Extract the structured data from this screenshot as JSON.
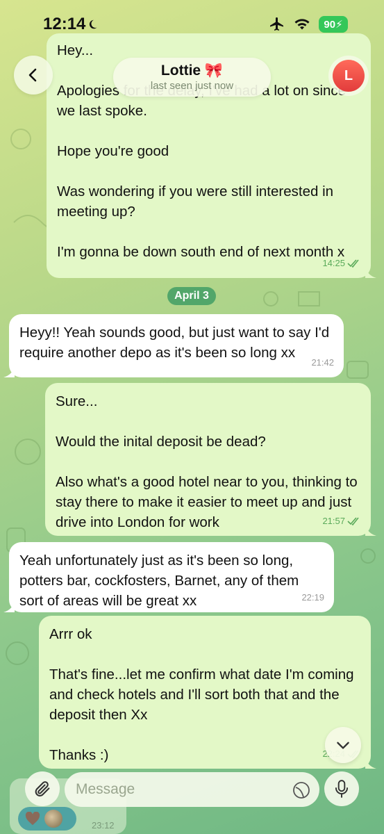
{
  "status_bar": {
    "time": "12:14",
    "battery": "90"
  },
  "header": {
    "contact_name": "Lottie 🎀",
    "last_seen": "last seen just now",
    "avatar_initial": "L"
  },
  "messages": [
    {
      "direction": "out",
      "text": "Hey...\n\nApologies for the delay, I've had a lot on since we last spoke.\n\nHope you're good\n\nWas wondering if you were still interested in meeting up?\n\nI'm gonna be down south end of next month x",
      "time": "14:25",
      "status": "read"
    },
    {
      "direction": "date",
      "text": "April 3"
    },
    {
      "direction": "in",
      "text": "Heyy!! Yeah sounds good, but just want to say I'd require another depo as it's been so long xx",
      "time": "21:42"
    },
    {
      "direction": "out",
      "text": "Sure...\n\nWould the inital deposit be dead?\n\nAlso what's a good hotel near to you, thinking to stay there to make it easier to meet up and just drive into London for work",
      "time": "21:57",
      "status": "read"
    },
    {
      "direction": "in",
      "text": "Yeah unfortunately just as it's been so long, potters bar, cockfosters, Barnet, any of them sort of areas will be great xx",
      "time": "22:19"
    },
    {
      "direction": "out",
      "text": "Arrr ok\n\nThat's fine...let me confirm what date I'm coming and check hotels and I'll sort both that and the deposit then Xx\n\nThanks :)",
      "time": "22:24",
      "status": "read"
    },
    {
      "direction": "in",
      "text": "",
      "time": "23:12",
      "reactions": [
        "heart",
        "avatar"
      ]
    }
  ],
  "input": {
    "placeholder": "Message"
  },
  "colors": {
    "outgoing_bubble": "#e3f8c7",
    "incoming_bubble": "#ffffff",
    "date_pill": "#52a66a",
    "read_check": "#5aaa5a",
    "battery": "#34c759",
    "avatar": "#e23c3c"
  },
  "icons": {
    "back": "chevron-left-icon",
    "moon": "moon-icon",
    "airplane": "airplane-icon",
    "wifi": "wifi-icon",
    "attach": "paperclip-icon",
    "sticker": "sticker-icon",
    "mic": "microphone-icon",
    "scroll_down": "chevron-down-icon"
  }
}
